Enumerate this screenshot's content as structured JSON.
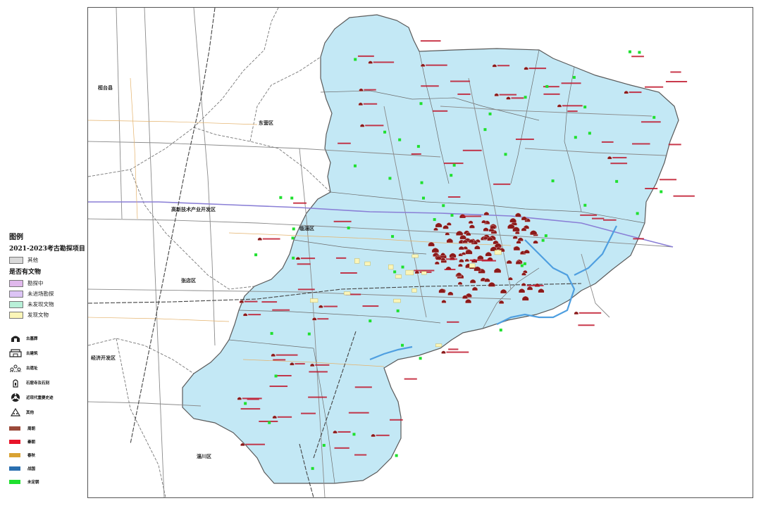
{
  "legend": {
    "title": "图例",
    "project_heading": "2021-2023考古勘探项目",
    "project_items": [
      {
        "label": "其他",
        "color": "#d9d9d9"
      }
    ],
    "relic_heading": "是否有文物",
    "relic_items": [
      {
        "label": "勘探中",
        "color": "#e0b8ec"
      },
      {
        "label": "未进场勘探",
        "color": "#dcc4f5"
      },
      {
        "label": "未发现文物",
        "color": "#b8f0d8"
      },
      {
        "label": "发现文物",
        "color": "#fbf5b8"
      }
    ],
    "site_types": [
      {
        "label": "古墓葬",
        "icon": "tomb-icon"
      },
      {
        "label": "古建筑",
        "icon": "ancient-building-icon"
      },
      {
        "label": "古遗址",
        "icon": "ancient-site-icon"
      },
      {
        "label": "石窟寺及石刻",
        "icon": "grotto-stone-carving-icon"
      },
      {
        "label": "近现代重要史迹",
        "icon": "modern-historic-site-icon"
      },
      {
        "label": "其他",
        "icon": "other-icon"
      }
    ],
    "periods": [
      {
        "label": "周朝",
        "color": "#9b4a3a"
      },
      {
        "label": "秦朝",
        "color": "#e8142a"
      },
      {
        "label": "春秋",
        "color": "#d9a233"
      },
      {
        "label": "战国",
        "color": "#2a6fb0"
      },
      {
        "label": "未定朝",
        "color": "#1fe02f"
      }
    ]
  },
  "map": {
    "colors": {
      "district_fill": "#c3e8f5",
      "district_stroke": "#5a5a5a",
      "river": "#4f9fe0",
      "road": "#7f7f7f",
      "rail": "#555555",
      "purple_road": "#8a7fd6",
      "site_marker": "#8b1a1a",
      "site_label": "#c0162b"
    },
    "place_labels": [
      "桓台县",
      "高新技术产业开发区",
      "张店区",
      "经济开发区",
      "临淄区",
      "东营区",
      "淄川区"
    ]
  }
}
